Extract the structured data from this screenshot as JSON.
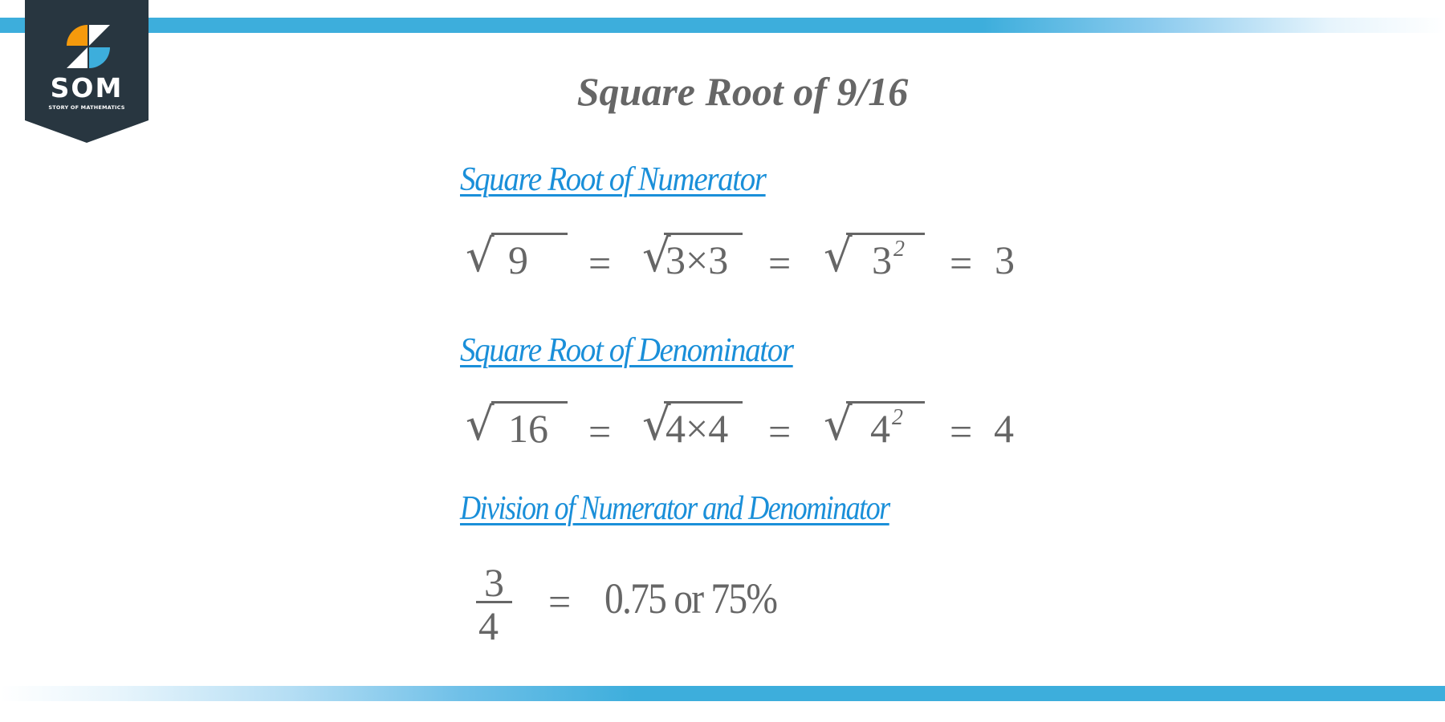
{
  "logo": {
    "name": "SOM",
    "tagline": "STORY OF MATHEMATICS",
    "colors": {
      "badge": "#283640",
      "orange": "#f59a0c",
      "blue": "#3daedc",
      "white": "#ffffff"
    }
  },
  "title": "Square Root of 9/16",
  "colors": {
    "heading": "#1a8fd9",
    "text": "#666666",
    "accent_bar": "#3daedc"
  },
  "sections": [
    {
      "heading": "Square Root of Numerator",
      "steps": [
        {
          "radicand": "9"
        },
        {
          "radicand": "3×3"
        },
        {
          "base": "3",
          "exponent": "2"
        }
      ],
      "equals": "=",
      "result": "3"
    },
    {
      "heading": "Square Root of Denominator",
      "steps": [
        {
          "radicand": "16"
        },
        {
          "radicand": "4×4"
        },
        {
          "base": "4",
          "exponent": "2"
        }
      ],
      "equals": "=",
      "result": "4"
    },
    {
      "heading": "Division of Numerator and Denominator",
      "fraction": {
        "numerator": "3",
        "denominator": "4"
      },
      "equals": "=",
      "result": "0.75 or 75%"
    }
  ],
  "symbols": {
    "radical": "√"
  }
}
